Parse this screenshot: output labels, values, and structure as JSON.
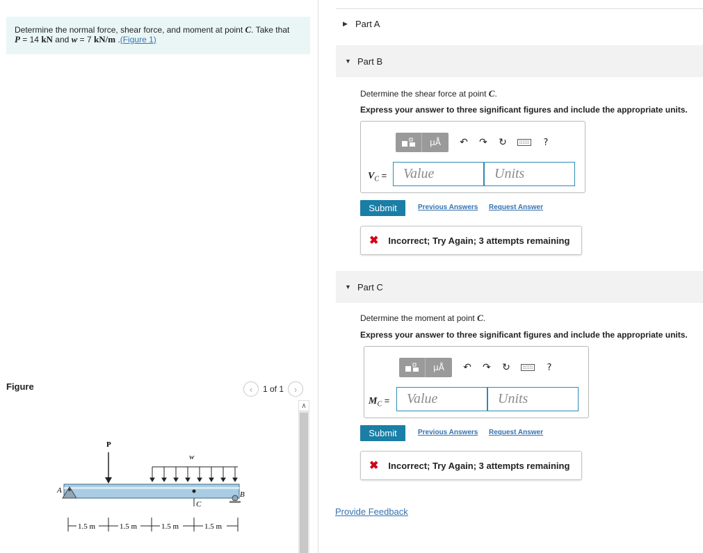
{
  "problem": {
    "line1": "Determine the normal force, shear force, and moment at point ",
    "point": "C",
    "line1_end": ". Take that",
    "p_var": "P",
    "p_eq": " = 14 ",
    "p_unit": "kN",
    "and": " and ",
    "w_var": "w",
    "w_eq": " = 7 ",
    "w_unit": "kN/m",
    "period": " .",
    "figure_link": "(Figure 1)"
  },
  "figure": {
    "label": "Figure",
    "pager_text": "1 of 1",
    "prev_icon": "chevron-left",
    "next_icon": "chevron-right",
    "diagram": {
      "P": "P",
      "w": "w",
      "A": "A",
      "B": "B",
      "C": "C",
      "dims": [
        "1.5 m",
        "1.5 m",
        "1.5 m",
        "1.5 m"
      ]
    }
  },
  "partA": {
    "label": "Part A"
  },
  "partB": {
    "label": "Part B",
    "question_start": "Determine the shear force at point ",
    "question_point": "C",
    "question_end": ".",
    "instruction": "Express your answer to three significant figures and include the appropriate units.",
    "toolbar": {
      "mu": "μÅ",
      "help": "?"
    },
    "var_main": "V",
    "var_sub": "C",
    "eq": " =",
    "value_placeholder": "Value",
    "units_placeholder": "Units",
    "submit": "Submit",
    "previous_answers": "Previous Answers",
    "request_answer": "Request Answer",
    "feedback": "Incorrect; Try Again; 3 attempts remaining"
  },
  "partC": {
    "label": "Part C",
    "question_start": "Determine the moment at point ",
    "question_point": "C",
    "question_end": ".",
    "instruction": "Express your answer to three significant figures and include the appropriate units.",
    "toolbar": {
      "mu": "μÅ",
      "help": "?"
    },
    "var_main": "M",
    "var_sub": "C",
    "eq": " =",
    "value_placeholder": "Value",
    "units_placeholder": "Units",
    "submit": "Submit",
    "previous_answers": "Previous Answers",
    "request_answer": "Request Answer",
    "feedback": "Incorrect; Try Again; 3 attempts remaining"
  },
  "provide_feedback": "Provide Feedback",
  "colors": {
    "accent": "#1a7ea6",
    "link": "#3572b0",
    "error": "#d0021b",
    "problem_bg": "#eaf6f6"
  }
}
